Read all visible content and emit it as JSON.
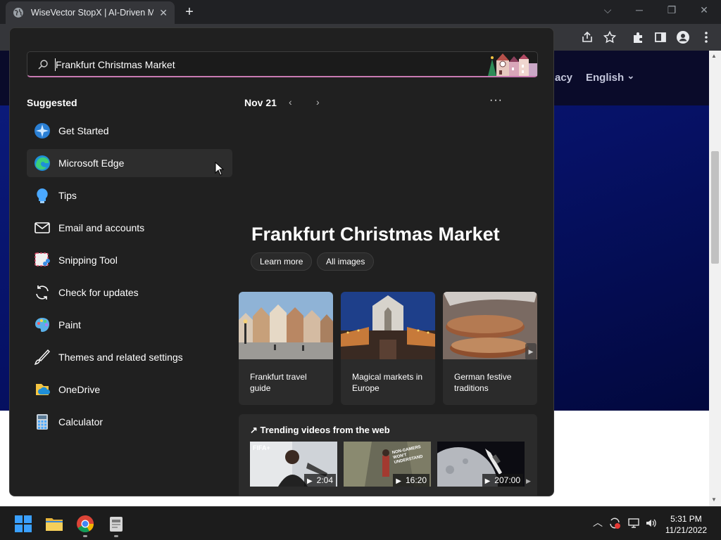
{
  "browser": {
    "tab_title": "WiseVector StopX | AI-Driven Ma",
    "tab_close": "✕",
    "new_tab": "+",
    "window_controls": {
      "list": "⌵",
      "minimize": "─",
      "restore": "❐",
      "close": "✕"
    }
  },
  "page": {
    "nav_partial": "acy",
    "nav_language": "English",
    "nav_chevron": "⌄"
  },
  "search": {
    "query": "Frankfurt Christmas Market"
  },
  "suggested": {
    "label": "Suggested",
    "items": [
      {
        "label": "Get Started",
        "icon": "get-started-icon"
      },
      {
        "label": "Microsoft Edge",
        "icon": "edge-icon"
      },
      {
        "label": "Tips",
        "icon": "tips-icon"
      },
      {
        "label": "Email and accounts",
        "icon": "mail-icon"
      },
      {
        "label": "Snipping Tool",
        "icon": "snipping-tool-icon"
      },
      {
        "label": "Check for updates",
        "icon": "refresh-icon"
      },
      {
        "label": "Paint",
        "icon": "paint-icon"
      },
      {
        "label": "Themes and related settings",
        "icon": "brush-icon"
      },
      {
        "label": "OneDrive",
        "icon": "onedrive-icon"
      },
      {
        "label": "Calculator",
        "icon": "calculator-icon"
      }
    ]
  },
  "highlights": {
    "date": "Nov 21",
    "prev": "‹",
    "next": "›",
    "more": "···",
    "title": "Frankfurt Christmas Market",
    "learn_more": "Learn more",
    "all_images": "All images",
    "cards": [
      {
        "caption": "Frankfurt travel guide"
      },
      {
        "caption": "Magical markets in Europe"
      },
      {
        "caption": "German festive traditions"
      }
    ],
    "card_next": "▶",
    "trending_title": "↗ Trending videos from the web",
    "videos": [
      {
        "duration": "2:04",
        "badge": "FIFA+"
      },
      {
        "duration": "16:20",
        "badge": "NON-GAMERS WON'T UNDERSTAND"
      },
      {
        "duration": "207:00",
        "badge": ""
      }
    ],
    "play": "▶",
    "video_next": "▶"
  },
  "taskbar": {
    "time": "5:31 PM",
    "date": "11/21/2022",
    "tray_chevron": "︿"
  },
  "colors": {
    "flyout_bg": "#202020",
    "accent_underline": "#c97ab3",
    "page_hero": "#061166"
  }
}
